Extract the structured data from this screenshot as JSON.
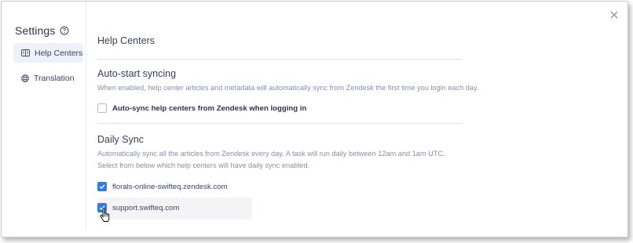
{
  "sidebar": {
    "title": "Settings",
    "items": [
      {
        "label": "Help Centers",
        "icon": "book-icon",
        "active": true
      },
      {
        "label": "Translation",
        "icon": "globe-icon",
        "active": false
      }
    ]
  },
  "main": {
    "title": "Help Centers",
    "autostart": {
      "heading": "Auto-start syncing",
      "description": "When enabled, help center articles and metadata will automatically sync from Zendesk the first time you login each day.",
      "checkbox_label": "Auto-sync help centers from Zendesk when logging in",
      "checked": false
    },
    "daily": {
      "heading": "Daily Sync",
      "description_line1": "Automatically sync all the articles from Zendesk every day. A task will run daily between 12am and 1am UTC.",
      "description_line2": "Select from below which help centers will have daily sync enabled.",
      "help_centers": [
        {
          "label": "florals-online-swifteq.zendesk.com",
          "checked": true
        },
        {
          "label": "support.swifteq.com",
          "checked": true
        }
      ]
    }
  },
  "colors": {
    "accent": "#2f7de1",
    "active_bg": "#edf2fa"
  }
}
